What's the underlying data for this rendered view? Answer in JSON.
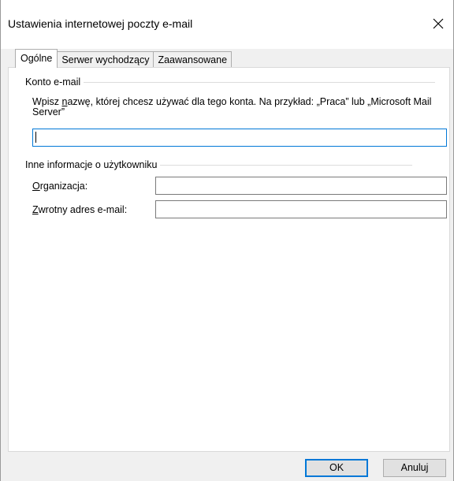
{
  "window": {
    "title": "Ustawienia internetowej poczty e-mail"
  },
  "tabs": [
    {
      "label": "Ogólne",
      "active": true
    },
    {
      "label": "Serwer wychodzący",
      "active": false
    },
    {
      "label": "Zaawansowane",
      "active": false
    }
  ],
  "account_group": {
    "heading": "Konto e-mail",
    "desc_prefix": "Wpisz ",
    "desc_accel": "n",
    "desc_rest": "azwę, której chcesz używać dla tego konta. Na przykład: „Praca” lub „Microsoft Mail Server”",
    "name_value": ""
  },
  "user_group": {
    "heading": "Inne informacje o użytkowniku",
    "org_accel": "O",
    "org_rest": "rganizacja:",
    "org_value": "",
    "reply_accel": "Z",
    "reply_rest": "wrotny adres e-mail:",
    "reply_value": ""
  },
  "buttons": {
    "ok": "OK",
    "cancel": "Anuluj"
  },
  "colors": {
    "accent": "#0078d7",
    "dialog_bg": "#f0f0f0",
    "panel_bg": "#ffffff"
  }
}
